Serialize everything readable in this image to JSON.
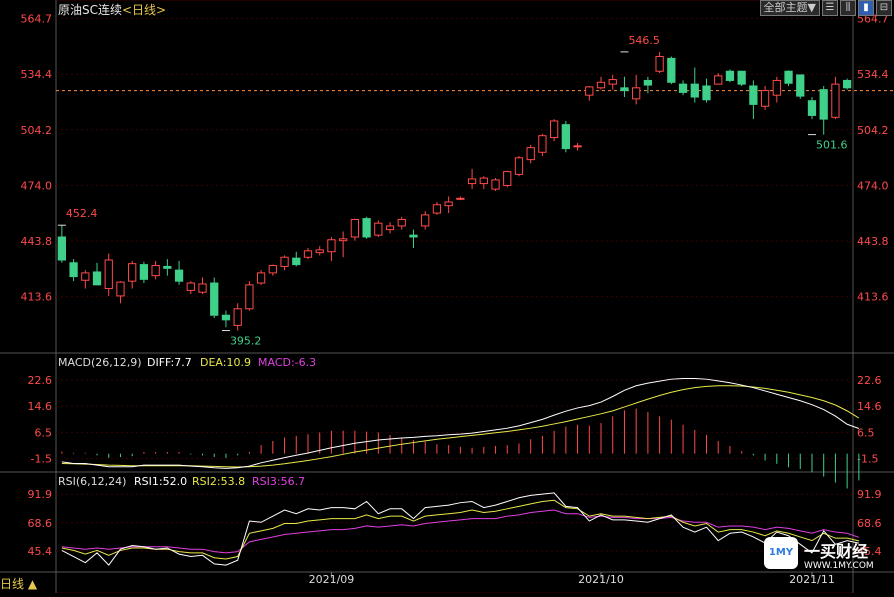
{
  "header": {
    "instrument": "原油SC连续",
    "period_label": "<日线>",
    "toolbar": {
      "theme_button": "全部主题▼",
      "icons": [
        "quote-list-icon",
        "kline-icon",
        "candle-style-icon",
        "split-icon"
      ]
    }
  },
  "bottom": {
    "period_toggle": "日线 ▲"
  },
  "watermark": {
    "logo_text": "1MY",
    "brand": "一买财经",
    "url": "WWW.1MY.COM"
  },
  "colors": {
    "up": "#ff4a4a",
    "down": "#3fd08a",
    "grid": "#3a0000",
    "axis_text": "#ff4a4a",
    "diff": "#ffffff",
    "dea": "#e8e84a",
    "rsi1": "#ffffff",
    "rsi2": "#e8e84a",
    "rsi3": "#e040e0",
    "price_line": "#ff8a3a"
  },
  "chart_data": [
    {
      "type": "candlestick",
      "name": "price",
      "y_ticks": [
        "564.7",
        "534.4",
        "504.2",
        "474.0",
        "443.8",
        "413.6"
      ],
      "ylim": [
        383.0,
        566.0
      ],
      "x_labels": [
        {
          "label": "2021/09",
          "index": 23
        },
        {
          "label": "2021/10",
          "index": 46
        },
        {
          "label": "2021/11",
          "index": 64
        }
      ],
      "reference_line": 525.5,
      "annotations": [
        {
          "text": "452.4",
          "index": 0,
          "value": 452.4
        },
        {
          "text": "395.2",
          "index": 14,
          "value": 395.2
        },
        {
          "text": "546.5",
          "index": 48,
          "value": 546.5
        },
        {
          "text": "501.6",
          "index": 64,
          "value": 501.6
        }
      ],
      "candles": [
        {
          "o": 446.0,
          "h": 452.4,
          "l": 432.0,
          "c": 433.5
        },
        {
          "o": 432.0,
          "h": 434.0,
          "l": 422.0,
          "c": 424.5
        },
        {
          "o": 422.5,
          "h": 428.0,
          "l": 418.0,
          "c": 426.5
        },
        {
          "o": 427.0,
          "h": 432.0,
          "l": 420.0,
          "c": 420.0
        },
        {
          "o": 418.0,
          "h": 437.0,
          "l": 414.0,
          "c": 433.5
        },
        {
          "o": 414.0,
          "h": 422.0,
          "l": 410.0,
          "c": 421.5
        },
        {
          "o": 422.0,
          "h": 433.0,
          "l": 418.0,
          "c": 431.5
        },
        {
          "o": 431.0,
          "h": 432.5,
          "l": 421.0,
          "c": 423.0
        },
        {
          "o": 425.0,
          "h": 433.0,
          "l": 423.0,
          "c": 430.5
        },
        {
          "o": 430.0,
          "h": 434.0,
          "l": 425.0,
          "c": 429.0
        },
        {
          "o": 428.0,
          "h": 433.0,
          "l": 420.0,
          "c": 422.0
        },
        {
          "o": 417.0,
          "h": 422.0,
          "l": 415.0,
          "c": 421.0
        },
        {
          "o": 416.0,
          "h": 424.0,
          "l": 415.0,
          "c": 420.5
        },
        {
          "o": 421.0,
          "h": 424.0,
          "l": 402.0,
          "c": 403.5
        },
        {
          "o": 403.5,
          "h": 406.0,
          "l": 397.0,
          "c": 401.0
        },
        {
          "o": 398.0,
          "h": 410.0,
          "l": 395.2,
          "c": 407.0
        },
        {
          "o": 407.0,
          "h": 422.0,
          "l": 406.0,
          "c": 420.0
        },
        {
          "o": 421.0,
          "h": 428.0,
          "l": 420.0,
          "c": 426.5
        },
        {
          "o": 426.5,
          "h": 431.0,
          "l": 425.0,
          "c": 430.5
        },
        {
          "o": 430.0,
          "h": 436.0,
          "l": 428.0,
          "c": 435.0
        },
        {
          "o": 434.5,
          "h": 438.0,
          "l": 430.0,
          "c": 431.0
        },
        {
          "o": 435.0,
          "h": 440.0,
          "l": 434.0,
          "c": 438.5
        },
        {
          "o": 437.5,
          "h": 441.0,
          "l": 436.0,
          "c": 439.0
        },
        {
          "o": 438.0,
          "h": 446.0,
          "l": 433.0,
          "c": 444.5
        },
        {
          "o": 444.0,
          "h": 449.0,
          "l": 435.0,
          "c": 445.0
        },
        {
          "o": 446.0,
          "h": 456.0,
          "l": 444.0,
          "c": 455.5
        },
        {
          "o": 456.0,
          "h": 457.0,
          "l": 445.0,
          "c": 446.0
        },
        {
          "o": 447.0,
          "h": 455.0,
          "l": 446.0,
          "c": 453.5
        },
        {
          "o": 450.0,
          "h": 454.0,
          "l": 448.0,
          "c": 452.0
        },
        {
          "o": 452.0,
          "h": 457.0,
          "l": 450.0,
          "c": 455.5
        },
        {
          "o": 447.0,
          "h": 450.0,
          "l": 440.0,
          "c": 446.0
        },
        {
          "o": 452.0,
          "h": 460.0,
          "l": 450.0,
          "c": 458.0
        },
        {
          "o": 459.0,
          "h": 465.0,
          "l": 458.0,
          "c": 463.5
        },
        {
          "o": 463.0,
          "h": 468.0,
          "l": 459.0,
          "c": 465.0
        },
        {
          "o": 467.0,
          "h": 468.0,
          "l": 466.0,
          "c": 467.0
        },
        {
          "o": 475.0,
          "h": 483.0,
          "l": 472.0,
          "c": 477.5
        },
        {
          "o": 475.0,
          "h": 479.0,
          "l": 472.0,
          "c": 478.0
        },
        {
          "o": 472.0,
          "h": 478.0,
          "l": 471.0,
          "c": 477.0
        },
        {
          "o": 474.0,
          "h": 482.0,
          "l": 473.0,
          "c": 481.5
        },
        {
          "o": 480.0,
          "h": 490.0,
          "l": 479.0,
          "c": 489.0
        },
        {
          "o": 488.0,
          "h": 496.0,
          "l": 486.0,
          "c": 494.5
        },
        {
          "o": 492.0,
          "h": 502.0,
          "l": 490.0,
          "c": 501.0
        },
        {
          "o": 500.0,
          "h": 510.0,
          "l": 498.0,
          "c": 509.0
        },
        {
          "o": 507.0,
          "h": 509.0,
          "l": 492.0,
          "c": 494.0
        },
        {
          "o": 495.0,
          "h": 497.0,
          "l": 493.0,
          "c": 495.5
        },
        {
          "o": 523.0,
          "h": 528.0,
          "l": 520.0,
          "c": 527.5
        },
        {
          "o": 527.0,
          "h": 533.0,
          "l": 526.0,
          "c": 530.0
        },
        {
          "o": 529.0,
          "h": 534.0,
          "l": 526.0,
          "c": 531.5
        },
        {
          "o": 527.0,
          "h": 533.0,
          "l": 522.0,
          "c": 525.5
        },
        {
          "o": 521.0,
          "h": 534.0,
          "l": 518.0,
          "c": 527.0
        },
        {
          "o": 531.0,
          "h": 533.0,
          "l": 524.0,
          "c": 528.5
        },
        {
          "o": 536.0,
          "h": 546.5,
          "l": 535.0,
          "c": 544.0
        },
        {
          "o": 543.0,
          "h": 544.0,
          "l": 529.0,
          "c": 530.0
        },
        {
          "o": 529.0,
          "h": 531.0,
          "l": 523.0,
          "c": 524.5
        },
        {
          "o": 529.0,
          "h": 538.0,
          "l": 519.0,
          "c": 522.0
        },
        {
          "o": 528.0,
          "h": 532.0,
          "l": 519.0,
          "c": 520.5
        },
        {
          "o": 529.0,
          "h": 535.0,
          "l": 529.0,
          "c": 533.5
        },
        {
          "o": 536.0,
          "h": 537.0,
          "l": 530.0,
          "c": 531.0
        },
        {
          "o": 536.0,
          "h": 536.0,
          "l": 528.0,
          "c": 529.0
        },
        {
          "o": 528.0,
          "h": 531.0,
          "l": 510.0,
          "c": 518.0
        },
        {
          "o": 517.0,
          "h": 528.0,
          "l": 515.0,
          "c": 525.5
        },
        {
          "o": 523.0,
          "h": 533.0,
          "l": 519.0,
          "c": 531.0
        },
        {
          "o": 536.0,
          "h": 536.5,
          "l": 528.0,
          "c": 529.5
        },
        {
          "o": 534.0,
          "h": 534.0,
          "l": 521.0,
          "c": 522.5
        },
        {
          "o": 520.0,
          "h": 522.0,
          "l": 510.0,
          "c": 512.0
        },
        {
          "o": 526.0,
          "h": 528.0,
          "l": 501.6,
          "c": 510.0
        },
        {
          "o": 511.0,
          "h": 533.0,
          "l": 510.0,
          "c": 529.0
        },
        {
          "o": 531.0,
          "h": 532.0,
          "l": 526.0,
          "c": 527.0
        }
      ]
    },
    {
      "type": "macd",
      "name": "MACD",
      "labels": {
        "title": "MACD(26,12,9)",
        "diff": "DIFF:7.7",
        "dea": "DEA:10.9",
        "macd": "MACD:-6.3"
      },
      "y_ticks": [
        "22.6",
        "14.6",
        "6.5",
        "-1.5"
      ],
      "ylim": [
        -5.0,
        25.0
      ],
      "diff": [
        -2.5,
        -3.0,
        -3.0,
        -3.5,
        -4.0,
        -4.0,
        -4.0,
        -3.5,
        -3.5,
        -3.5,
        -3.5,
        -3.8,
        -4.0,
        -4.3,
        -4.5,
        -4.3,
        -3.8,
        -2.8,
        -2.0,
        -1.2,
        -0.5,
        0.2,
        1.0,
        1.8,
        2.5,
        3.2,
        3.7,
        4.2,
        4.5,
        4.8,
        5.0,
        5.3,
        5.5,
        5.8,
        6.0,
        6.3,
        6.8,
        7.3,
        7.8,
        8.5,
        9.5,
        10.5,
        11.8,
        13.0,
        14.0,
        14.7,
        15.8,
        17.5,
        19.4,
        20.8,
        21.6,
        22.2,
        22.8,
        23.0,
        23.0,
        22.8,
        22.3,
        21.7,
        21.0,
        20.2,
        19.2,
        18.2,
        17.2,
        16.2,
        15.0,
        13.5,
        11.5,
        9.0,
        7.7
      ],
      "dea": [
        -3.0,
        -3.1,
        -3.2,
        -3.3,
        -3.5,
        -3.6,
        -3.7,
        -3.7,
        -3.7,
        -3.7,
        -3.7,
        -3.7,
        -3.8,
        -3.9,
        -4.0,
        -4.1,
        -4.0,
        -3.8,
        -3.5,
        -3.1,
        -2.6,
        -2.1,
        -1.5,
        -0.9,
        -0.2,
        0.5,
        1.1,
        1.7,
        2.3,
        2.9,
        3.4,
        3.9,
        4.4,
        4.8,
        5.2,
        5.6,
        6.0,
        6.4,
        6.8,
        7.3,
        7.8,
        8.4,
        9.1,
        9.8,
        10.6,
        11.4,
        12.2,
        13.1,
        14.3,
        15.5,
        16.7,
        17.8,
        18.8,
        19.6,
        20.2,
        20.6,
        20.8,
        20.8,
        20.7,
        20.4,
        20.0,
        19.4,
        18.8,
        18.0,
        17.2,
        16.2,
        14.9,
        13.1,
        10.9
      ],
      "macd": [
        0.5,
        0.2,
        0.2,
        -0.4,
        -1.0,
        -0.8,
        -0.6,
        0.4,
        0.4,
        0.4,
        0.4,
        -0.2,
        -0.4,
        -0.8,
        -1.0,
        -0.4,
        0.4,
        2.0,
        3.0,
        3.8,
        4.2,
        4.6,
        5.0,
        5.4,
        5.4,
        5.4,
        5.2,
        5.0,
        4.4,
        3.8,
        3.2,
        2.8,
        2.2,
        2.0,
        1.6,
        1.4,
        1.6,
        1.8,
        2.0,
        2.4,
        3.4,
        4.2,
        5.4,
        6.4,
        6.8,
        6.6,
        7.2,
        8.8,
        10.2,
        10.6,
        9.8,
        8.8,
        8.0,
        6.8,
        5.6,
        4.4,
        3.0,
        1.8,
        0.6,
        -0.4,
        -1.6,
        -2.4,
        -3.2,
        -3.6,
        -4.4,
        -5.4,
        -6.8,
        -8.2,
        -6.3
      ]
    },
    {
      "type": "rsi",
      "name": "RSI",
      "labels": {
        "title": "RSI(6,12,24)",
        "rsi1": "RSI1:52.0",
        "rsi2": "RSI2:53.8",
        "rsi3": "RSI3:56.7"
      },
      "y_ticks": [
        "91.9",
        "68.6",
        "45.4"
      ],
      "ylim": [
        30.0,
        97.0
      ],
      "rsi1": [
        46,
        41,
        36,
        44,
        34,
        47,
        50,
        49,
        47,
        48,
        43,
        41,
        42,
        35,
        34,
        38,
        70,
        69,
        74,
        79,
        76,
        80,
        79,
        81,
        81,
        80,
        86,
        76,
        80,
        80,
        72,
        81,
        82,
        83,
        85,
        86,
        81,
        83,
        86,
        89,
        91,
        92,
        93,
        82,
        81,
        70,
        75,
        71,
        71,
        70,
        69,
        72,
        75,
        65,
        61,
        65,
        54,
        60,
        61,
        57,
        52,
        61,
        58,
        51,
        44,
        62,
        51,
        54,
        52
      ],
      "rsi2": [
        48,
        46,
        43,
        46,
        42,
        46,
        48,
        48,
        47,
        47,
        45,
        44,
        44,
        40,
        39,
        41,
        60,
        62,
        64,
        68,
        68,
        70,
        71,
        72,
        72,
        72,
        75,
        72,
        74,
        74,
        70,
        74,
        75,
        76,
        77,
        79,
        77,
        78,
        80,
        82,
        84,
        86,
        87,
        81,
        80,
        74,
        76,
        74,
        74,
        73,
        72,
        73,
        74,
        69,
        66,
        68,
        61,
        63,
        63,
        61,
        58,
        62,
        60,
        57,
        54,
        60,
        56,
        56,
        53.8
      ],
      "rsi3": [
        49,
        48,
        47,
        48,
        47,
        48,
        49,
        49,
        49,
        49,
        48,
        47,
        47,
        45,
        44,
        45,
        53,
        55,
        57,
        59,
        60,
        61,
        62,
        63,
        63,
        64,
        66,
        65,
        66,
        67,
        66,
        68,
        69,
        70,
        71,
        72,
        72,
        72,
        74,
        75,
        77,
        78,
        79,
        76,
        76,
        73,
        74,
        73,
        73,
        72,
        72,
        72,
        73,
        70,
        69,
        69,
        65,
        66,
        66,
        65,
        63,
        65,
        64,
        62,
        60,
        63,
        61,
        60,
        56.7
      ]
    }
  ]
}
